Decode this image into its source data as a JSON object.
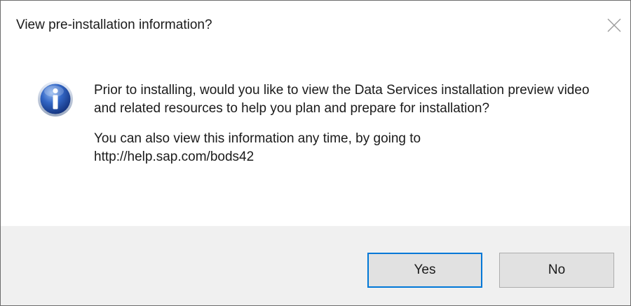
{
  "dialog": {
    "title": "View pre-installation information?",
    "icon": "info-icon",
    "message": {
      "paragraph1": "Prior to installing, would you like to view the Data Services installation preview video and related resources to help you plan and prepare for installation?",
      "paragraph2_line1": "You can also view this information any time, by going to",
      "paragraph2_line2": "http://help.sap.com/bods42"
    },
    "buttons": {
      "yes_label": "Yes",
      "no_label": "No"
    },
    "colors": {
      "focus_border": "#0078d7",
      "footer_bg": "#f0f0f0",
      "button_bg": "#e1e1e1"
    }
  }
}
